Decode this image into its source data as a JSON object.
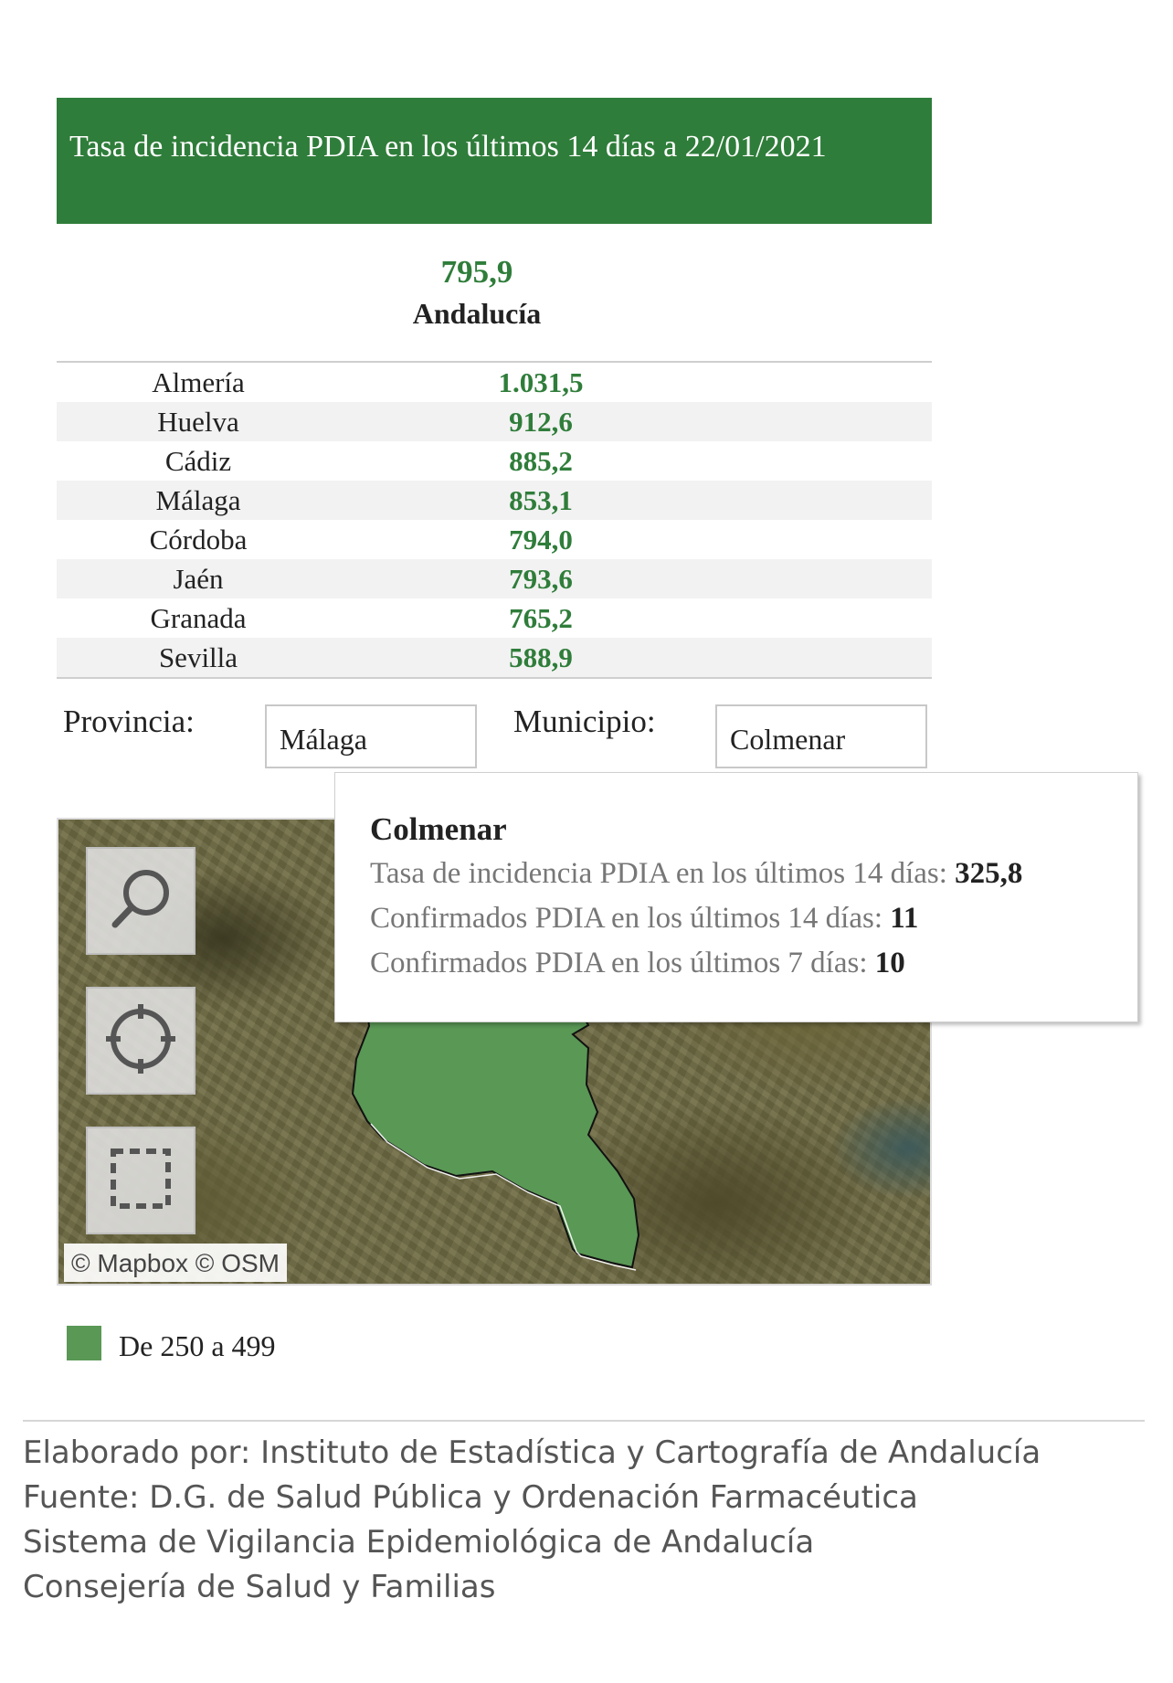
{
  "header": {
    "title": "Tasa de incidencia PDIA en los últimos 14 días a 22/01/2021"
  },
  "total": {
    "value": "795,9",
    "region": "Andalucía"
  },
  "provinces": [
    {
      "name": "Almería",
      "value": "1.031,5"
    },
    {
      "name": "Huelva",
      "value": "912,6"
    },
    {
      "name": "Cádiz",
      "value": "885,2"
    },
    {
      "name": "Málaga",
      "value": "853,1"
    },
    {
      "name": "Córdoba",
      "value": "794,0"
    },
    {
      "name": "Jaén",
      "value": "793,6"
    },
    {
      "name": "Granada",
      "value": "765,2"
    },
    {
      "name": "Sevilla",
      "value": "588,9"
    }
  ],
  "filters": {
    "provincia_label": "Provincia:",
    "provincia_value": "Málaga",
    "municipio_label": "Municipio:",
    "municipio_value": "Colmenar"
  },
  "map": {
    "attribution": "© Mapbox  © OSM",
    "controls": [
      "search-icon",
      "locate-icon",
      "select-area-icon"
    ],
    "highlight_color": "#5a9855"
  },
  "tooltip": {
    "title": "Colmenar",
    "lines": [
      {
        "label": "Tasa de incidencia PDIA en los últimos 14 días: ",
        "value": "325,8"
      },
      {
        "label": "Confirmados PDIA en los últimos 14 días: ",
        "value": "11"
      },
      {
        "label": "Confirmados PDIA en los últimos 7 días: ",
        "value": "10"
      }
    ]
  },
  "legend": {
    "label": "De 250 a 499",
    "color": "#5a9855"
  },
  "footer": {
    "lines": [
      "Elaborado por: Instituto de Estadística y Cartografía de Andalucía",
      "Fuente: D.G. de Salud Pública y Ordenación Farmacéutica",
      "Sistema de Vigilancia Epidemiológica de Andalucía",
      "Consejería de Salud y Familias"
    ]
  },
  "colors": {
    "brand_green": "#2f7d3a"
  }
}
